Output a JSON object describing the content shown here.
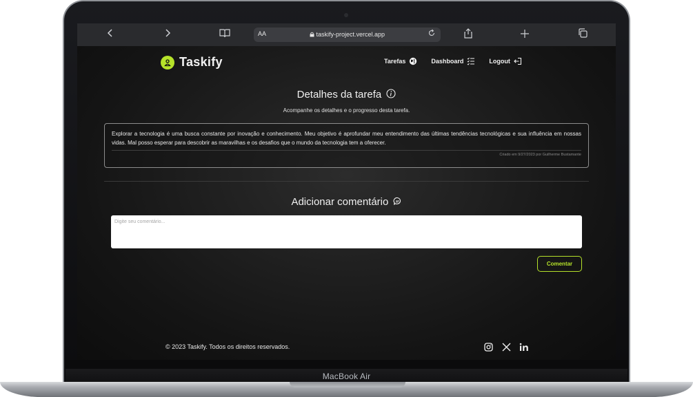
{
  "device": {
    "label": "MacBook Air"
  },
  "browser": {
    "url_aa": "AA",
    "url": "taskify-project.vercel.app"
  },
  "brand": {
    "name": "Taskify",
    "accent": "#b6e32a"
  },
  "nav": {
    "tarefas": "Tarefas",
    "dashboard": "Dashboard",
    "logout": "Logout"
  },
  "task": {
    "title": "Detalhes da tarefa",
    "subtitle": "Acompanhe os detalhes e o progresso desta tarefa.",
    "description": "Explorar a tecnologia é uma busca constante por inovação e conhecimento. Meu objetivo é aprofundar meu entendimento das últimas tendências tecnológicas e sua influência em nossas vidas. Mal posso esperar para descobrir as maravilhas e os desafios que o mundo da tecnologia tem a oferecer.",
    "meta": "Criado em 9/27/2023 por Guilherme Bustamante"
  },
  "comments": {
    "title": "Adicionar comentário",
    "placeholder": "Digite seu comentário...",
    "submit_label": "Comentar"
  },
  "footer": {
    "copyright": "© 2023 Taskify. Todos os direitos reservados."
  },
  "icons": {
    "back": "chevron-left-icon",
    "forward": "chevron-right-icon",
    "reader": "book-icon",
    "share": "share-icon",
    "new_tab": "plus-icon",
    "tabs": "tabs-icon"
  }
}
